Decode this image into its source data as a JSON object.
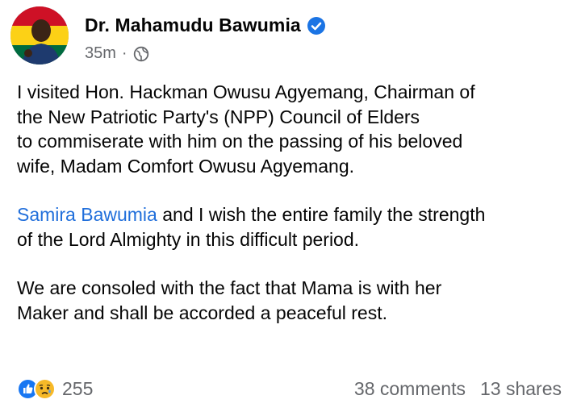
{
  "post": {
    "author_name": "Dr. Mahamudu Bawumia",
    "timestamp": "35m",
    "separator": "·",
    "audience_icon": "globe-icon",
    "verified_icon": "verified-badge-icon",
    "paragraph1": [
      "I visited Hon. Hackman Owusu Agyemang, Chairman of",
      "the New Patriotic Party's (NPP) Council of Elders",
      "to commiserate with him on the passing of his beloved",
      "wife, Madam Comfort Owusu Agyemang."
    ],
    "paragraph2_link": "Samira Bawumia",
    "paragraph2_rest_line1": " and I wish the entire family the strength",
    "paragraph2_line2": "of the Lord Almighty in this difficult period.",
    "paragraph3": [
      "We are consoled with the fact that Mama is with her",
      "Maker and shall be accorded a peaceful rest."
    ]
  },
  "footer": {
    "reaction_icons": [
      "like-icon",
      "sad-icon"
    ],
    "reaction_count": "255",
    "comments": "38 comments",
    "shares": "13 shares"
  },
  "colors": {
    "link": "#216fdb",
    "secondary_text": "#65676b",
    "verified": "#1b74e4",
    "like": "#1877f2",
    "sad": "#f7b928"
  }
}
